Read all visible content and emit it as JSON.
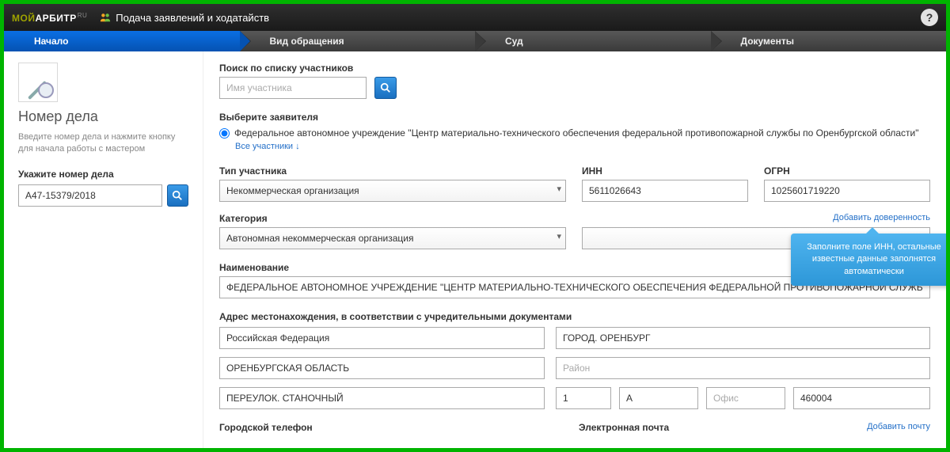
{
  "topbar": {
    "logo_moy": "МОЙ",
    "logo_arb": "АРБИТР",
    "logo_ru": "RU",
    "title": "Подача заявлений и ходатайств"
  },
  "steps": {
    "s1": "Начало",
    "s2": "Вид обращения",
    "s3": "Суд",
    "s4": "Документы"
  },
  "sidebar": {
    "heading": "Номер дела",
    "desc": "Введите номер дела и нажмите кнопку для начала работы с мастером",
    "label": "Укажите номер дела",
    "case_value": "А47-15379/2018"
  },
  "main": {
    "search_label": "Поиск по списку участников",
    "search_placeholder": "Имя участника",
    "select_applicant_label": "Выберите заявителя",
    "applicant_name": "Федеральное автономное учреждение \"Центр материально-технического обеспечения федеральной противопожарной службы по Оренбургской области\"",
    "all_participants": "Все участники ↓",
    "type_label": "Тип участника",
    "type_value": "Некоммерческая организация",
    "inn_label": "ИНН",
    "inn_value": "5611026643",
    "ogrn_label": "ОГРН",
    "ogrn_value": "1025601719220",
    "category_label": "Категория",
    "category_value": "Автономная некоммерческая организация",
    "add_proxy": "Добавить доверенность",
    "name_label": "Наименование",
    "name_value": "ФЕДЕРАЛЬНОЕ АВТОНОМНОЕ УЧРЕЖДЕНИЕ \"ЦЕНТР МАТЕРИАЛЬНО-ТЕХНИЧЕСКОГО ОБЕСПЕЧЕНИЯ ФЕДЕРАЛЬНОЙ ПРОТИВОПОЖАРНОЙ СЛУЖБЫ ПО ОРЕНБУРГСКОЙ ОБЛАСТИ\"",
    "addr_label": "Адрес местонахождения, в соответствии с учредительными документами",
    "addr_country": "Российская Федерация",
    "addr_city": "ГОРОД. ОРЕНБУРГ",
    "addr_region": "ОРЕНБУРГСКАЯ ОБЛАСТЬ",
    "addr_district_ph": "Район",
    "addr_street": "ПЕРЕУЛОК. СТАНОЧНЫЙ",
    "addr_house": "1",
    "addr_building": "А",
    "addr_office_ph": "Офис",
    "addr_zip": "460004",
    "phone_label": "Городской телефон",
    "email_label": "Электронная почта",
    "add_email": "Добавить почту",
    "tooltip": "Заполните поле ИНН, остальные известные данные заполнятся автоматически"
  }
}
